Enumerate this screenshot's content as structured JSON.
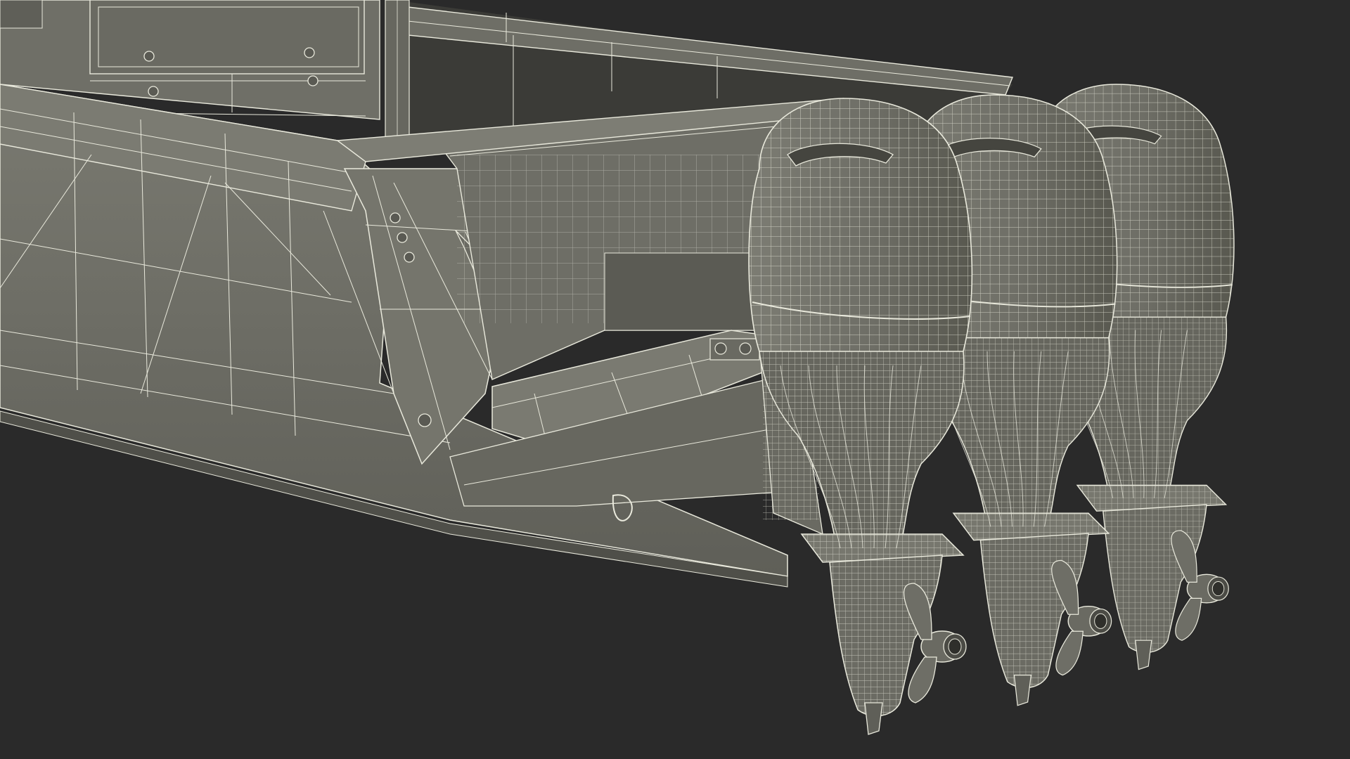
{
  "scene": {
    "background_color": "#2a2a2a",
    "surface_color": "#6f6f67",
    "surface_shadow_color": "#55554f",
    "surface_light_color": "#85857c",
    "wire_color": "#e9e9dc",
    "engine_count": 3
  }
}
